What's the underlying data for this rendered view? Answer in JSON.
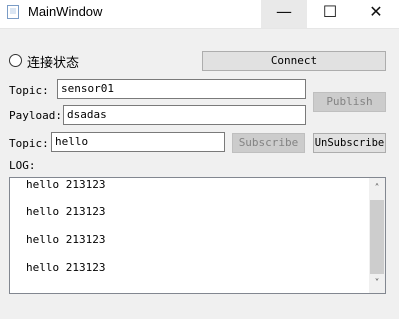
{
  "window": {
    "title": "MainWindow",
    "minimize_glyph": "—",
    "maximize_glyph": "☐",
    "close_glyph": "✕"
  },
  "status": {
    "label": "连接状态",
    "checked": false
  },
  "connect_button": {
    "label": "Connect"
  },
  "publish_section": {
    "topic_label": "Topic:",
    "topic_value": "sensor01",
    "payload_label": "Payload:",
    "payload_value": "dsadas",
    "publish_button": {
      "label": "Publish",
      "enabled": false
    }
  },
  "subscribe_section": {
    "topic_label": "Topic:",
    "topic_value": "hello",
    "subscribe_button": {
      "label": "Subscribe",
      "enabled": false
    },
    "unsubscribe_button": {
      "label": "UnSubscribe",
      "enabled": true
    }
  },
  "log": {
    "label": "LOG:",
    "lines": [
      "hello 213123",
      "hello 213123",
      "hello 213123",
      "hello 213123"
    ],
    "scrollbar": {
      "up_icon": "˄",
      "down_icon": "˅"
    }
  },
  "icons": {
    "app": "window-icon"
  },
  "colors": {
    "window_bg": "#f0f0f0",
    "button_bg": "#e1e1e1",
    "disabled_text": "#838383"
  }
}
